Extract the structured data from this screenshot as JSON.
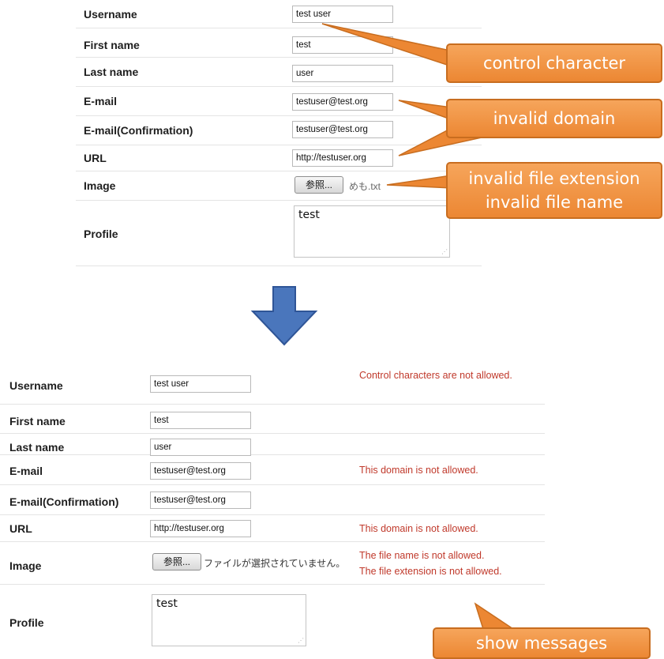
{
  "before_form": {
    "rows": [
      {
        "label": "Username",
        "value": "test  user"
      },
      {
        "label": "First name",
        "value": "test"
      },
      {
        "label": "Last name",
        "value": "user"
      },
      {
        "label": "E-mail",
        "value": "testuser@test.org"
      },
      {
        "label": "E-mail(Confirmation)",
        "value": "testuser@test.org"
      },
      {
        "label": "URL",
        "value": "http://testuser.org"
      },
      {
        "label": "Image",
        "button": "参照...",
        "file_name": "めも.txt"
      },
      {
        "label": "Profile",
        "value": "test"
      }
    ]
  },
  "callouts": {
    "control": "control character",
    "domain": "invalid domain",
    "file_ext": "invalid file extension",
    "file_name": "invalid file name",
    "show": "show messages"
  },
  "after_form": {
    "rows": [
      {
        "label": "Username",
        "value": "test  user",
        "error": "Control characters are not allowed."
      },
      {
        "label": "First name",
        "value": "test"
      },
      {
        "label": "Last name",
        "value": "user"
      },
      {
        "label": "E-mail",
        "value": "testuser@test.org",
        "error": "This domain is not allowed."
      },
      {
        "label": "E-mail(Confirmation)",
        "value": "testuser@test.org"
      },
      {
        "label": "URL",
        "value": "http://testuser.org",
        "error": "This domain is not allowed."
      },
      {
        "label": "Image",
        "button": "参照...",
        "file_name": "ファイルが選択されていません。",
        "error": "The file name is not allowed.",
        "error2": "The file extension is not allowed."
      },
      {
        "label": "Profile",
        "value": "test"
      }
    ]
  },
  "colors": {
    "callout": "#ec8733",
    "arrow": "#4a76bc",
    "error": "#c0392b"
  }
}
